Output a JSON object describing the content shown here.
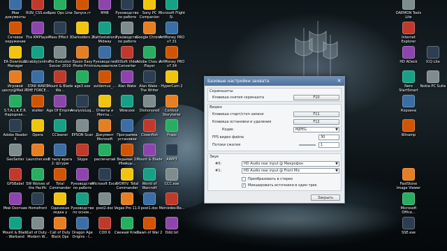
{
  "desktop": {
    "row1": [
      "Мои документы",
      "RUN_CSS.exe",
      "Spec Ops Line",
      "Запуск.гг",
      "MHB",
      "Руководство по работе",
      "Sony PC Companion",
      "Microsoft Flight Si.",
      "DAEMON Tools Lite"
    ],
    "row2": [
      "Сетевое окружение",
      "The KMPlayer",
      "Mass Effect 3",
      "Darksiders 2",
      "Battlestations Midway",
      "Руководство по работе",
      "Google Chrome",
      "ArtMoney PRO v7.31",
      "Internet Explorer"
    ],
    "row3": [
      "EA Download Manager",
      "Scrabby(online)",
      "Pro Evolution Soccer 2010",
      "Epson Easy Photo Print",
      "Руководство пользователя",
      "XiliSoft Video Converter",
      "Adobe Chou au Player",
      "ArtMoney PRO v7.34",
      "HD ADeck",
      "ICQ Lite"
    ],
    "row4": [
      "Игровой центр@Mail.Ru",
      "STAR WARS THE FORCE...",
      "Mount & Blade Wa...",
      "age3.exe",
      "avidemux_...",
      "Alan Wake",
      "Alan Wake - The Writer",
      "HyperCam 2",
      "Nero StartSmart",
      "Nokia PC Suite"
    ],
    "row5": [
      "S.T.A.L.K.E.R. Народная...",
      "stalker",
      "Age Of Empires II",
      "AnalysisLog...",
      "Ответы и Мечты...",
      "Wow.exe",
      "Dishonored",
      "Contour Storyteller",
      "Корзина"
    ],
    "row6": [
      "Adobe Reader X",
      "Opera",
      "CCleaner",
      "EPSON Scan",
      "Документ Microsoft",
      "Программа установки",
      "Clownfish",
      "Fraps",
      "Winamp"
    ],
    "row7": [
      "GeoSetter",
      "Launcher.exe",
      "В тылу врага 2: Штурм",
      "Skype",
      "распечатай",
      "Ведьмак 2: Убийцы...",
      "Mount & Blade",
      "AIMP3"
    ],
    "row8": [
      "GPSBabel",
      "SW Wolves of the Pacific",
      "Total Commander",
      "Руководство по работе",
      "Microsoft Excel",
      "IVORYV. Total Commander",
      "World of Warcraft",
      "CCC.exe",
      "FastStone Image Viewer"
    ],
    "row9": [
      "Мой Охотник",
      "Homefront",
      "Одинокая лодка у острова",
      "Руководство по основ...",
      "post2.doc",
      "Vegas Pro 11.0",
      "post1.doc",
      "Mercedes-Be...",
      "Microsoft Office..."
    ],
    "row10": [
      "Mount & Blade - Warband",
      "Call of Duty - Modern W...",
      "Call of Duty Black Ops",
      "Dragon Age Origins - I...",
      "COD 6",
      "Свежий Ключ",
      "Dawn of War 2",
      "Ddd.txt",
      "SSE.exe"
    ]
  },
  "dialog": {
    "title": "Базовые настройки захвата",
    "close": "✕",
    "screenshots": {
      "title": "Скриншоты",
      "key_label": "Клавиша снятия скриншота",
      "key_value": "F10"
    },
    "video": {
      "title": "Видео",
      "start_stop_label": "Клавиша старт/стоп записи",
      "start_stop_value": "F11",
      "pause_label": "Клавиша остановки и удаления",
      "pause_value": "F12",
      "codec_label": "Кодек",
      "codec_value": "MJPEG",
      "fps_label": "FPS видео файла",
      "fps_value": "30",
      "threads_label": "Потоки сжатия",
      "threads_value": "1"
    },
    "sound": {
      "title": "Звук",
      "ch0_label": "#0:",
      "ch0_value": "HD Audio rear input @ Микрофон",
      "ch1_label": "#1:",
      "ch1_value": "HD Audio rear input @ Front Mic",
      "stereo_label": "Преобразовать в стерео",
      "stereo_checked": false,
      "mix_label": "Микшировать источники в один трек",
      "mix_checked": true
    },
    "close_button": "Закрыть"
  },
  "colors": {
    "titlebar": "#5a7fa8",
    "dialog_bg": "#e9ecef"
  }
}
